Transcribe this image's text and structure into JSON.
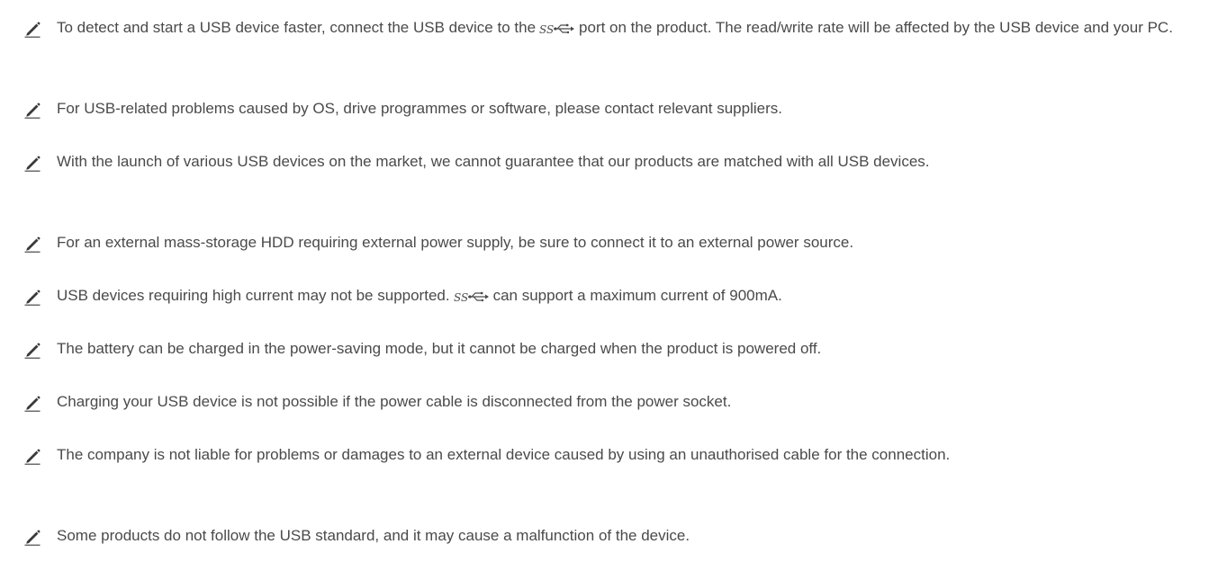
{
  "notes": [
    {
      "icon": "pencil-icon",
      "before": "To detect and start a USB device faster, connect the USB device to the",
      "inline_icon": "usb-superspeed-icon",
      "after": "port on the product. The read/write rate will be affected by the USB device and your PC."
    },
    {
      "icon": "pencil-icon",
      "text": "For USB-related problems caused by OS, drive programmes or software, please contact relevant suppliers."
    },
    {
      "icon": "pencil-icon",
      "text": "With the launch of various USB devices on the market, we cannot guarantee that our products are matched with all USB devices."
    },
    {
      "icon": "pencil-icon",
      "text": "For an external mass-storage HDD requiring external power supply, be sure to connect it to an external power source."
    },
    {
      "icon": "pencil-icon",
      "before": "USB devices requiring high current may not be supported.",
      "inline_icon": "usb-superspeed-icon",
      "after": "can support a maximum current of 900mA."
    },
    {
      "icon": "pencil-icon",
      "text": "The battery can be charged in the power-saving mode, but it cannot be charged when the product is powered off."
    },
    {
      "icon": "pencil-icon",
      "text": "Charging your USB device is not possible if the power cable is disconnected from the power socket."
    },
    {
      "icon": "pencil-icon",
      "text": "The company is not liable for problems or damages to an external device caused by using an unauthorised cable for the connection."
    },
    {
      "icon": "pencil-icon",
      "text": "Some products do not follow the USB standard, and it may cause a malfunction of the device."
    }
  ],
  "colors": {
    "text": "#4a4a4a",
    "icon": "#3a3a3a"
  }
}
